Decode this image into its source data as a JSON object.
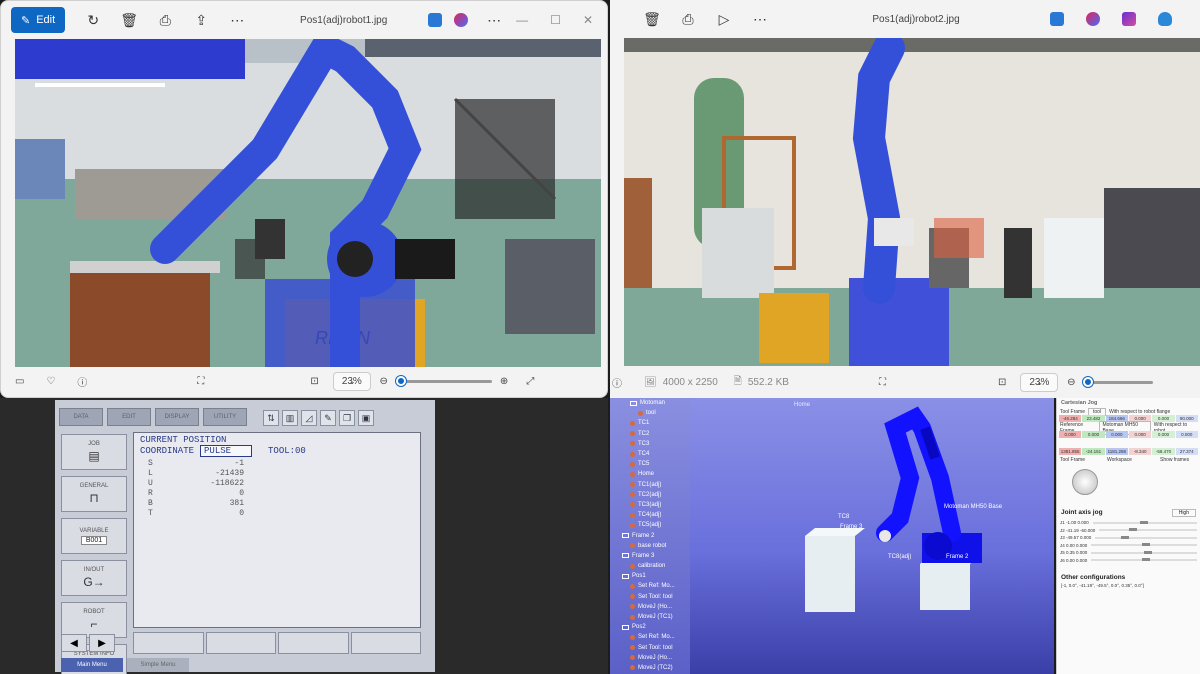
{
  "window1": {
    "edit_label": "Edit",
    "filename": "Pos1(adj)robot1.jpg",
    "zoom": "23%"
  },
  "window2": {
    "filename": "Pos1(adj)robot2.jpg",
    "dimensions": "4000 x 2250",
    "filesize": "552.2 KB",
    "zoom": "23%"
  },
  "pendant": {
    "tabs": [
      "DATA",
      "EDIT",
      "DISPLAY",
      "UTILITY"
    ],
    "side_buttons": [
      {
        "label": "JOB",
        "glyph": "▤"
      },
      {
        "label": "GENERAL",
        "glyph": "⊓"
      },
      {
        "label": "VARIABLE",
        "sub": "B001"
      },
      {
        "label": "IN/OUT",
        "glyph": "G→"
      },
      {
        "label": "ROBOT",
        "glyph": "⌐"
      },
      {
        "label": "SYSTEM INFO",
        "glyph": "▣"
      }
    ],
    "screen_title": "CURRENT POSITION",
    "coordinate_label": "COORDINATE",
    "coordinate_value": "PULSE",
    "tool_label": "TOOL:00",
    "axes": [
      {
        "axis": "S",
        "value": "-1"
      },
      {
        "axis": "L",
        "value": "-21439"
      },
      {
        "axis": "U",
        "value": "-118622"
      },
      {
        "axis": "R",
        "value": "0"
      },
      {
        "axis": "B",
        "value": "381"
      },
      {
        "axis": "T",
        "value": "0"
      }
    ],
    "menu_main": "Main Menu",
    "menu_simple": "Simple Menu"
  },
  "robodk": {
    "tree": [
      {
        "label": "Motoman",
        "kind": "frame",
        "indent": 2
      },
      {
        "label": "tool",
        "kind": "dot",
        "indent": 3
      },
      {
        "label": "TC1",
        "kind": "dot",
        "indent": 2
      },
      {
        "label": "TC2",
        "kind": "dot",
        "indent": 2
      },
      {
        "label": "TC3",
        "kind": "dot",
        "indent": 2
      },
      {
        "label": "TC4",
        "kind": "dot",
        "indent": 2
      },
      {
        "label": "TC5",
        "kind": "dot",
        "indent": 2
      },
      {
        "label": "Home",
        "kind": "dot",
        "indent": 2
      },
      {
        "label": "TC1(adj)",
        "kind": "dot",
        "indent": 2
      },
      {
        "label": "TC2(adj)",
        "kind": "dot",
        "indent": 2
      },
      {
        "label": "TC3(adj)",
        "kind": "dot",
        "indent": 2
      },
      {
        "label": "TC4(adj)",
        "kind": "dot",
        "indent": 2
      },
      {
        "label": "TC5(adj)",
        "kind": "dot",
        "indent": 2
      },
      {
        "label": "Frame 2",
        "kind": "frame",
        "indent": 1
      },
      {
        "label": "base robot",
        "kind": "dot",
        "indent": 2
      },
      {
        "label": "Frame 3",
        "kind": "frame",
        "indent": 1
      },
      {
        "label": "calibration",
        "kind": "dot",
        "indent": 2
      },
      {
        "label": "Pos1",
        "kind": "frame",
        "indent": 1
      },
      {
        "label": "Set Ref: Mo...",
        "kind": "dot",
        "indent": 2
      },
      {
        "label": "Set Tool: tool",
        "kind": "dot",
        "indent": 2
      },
      {
        "label": "MoveJ (Ho...",
        "kind": "dot",
        "indent": 2
      },
      {
        "label": "MoveJ (TC1)",
        "kind": "dot",
        "indent": 2
      },
      {
        "label": "Pos2",
        "kind": "frame",
        "indent": 1
      },
      {
        "label": "Set Ref: Mo...",
        "kind": "dot",
        "indent": 2
      },
      {
        "label": "Set Tool: tool",
        "kind": "dot",
        "indent": 2
      },
      {
        "label": "MoveJ (Ho...",
        "kind": "dot",
        "indent": 2
      },
      {
        "label": "MoveJ (TC2)",
        "kind": "dot",
        "indent": 2
      }
    ],
    "view_home": "Home",
    "label_tc8": "TC8",
    "label_frame3": "Frame 3",
    "label_robot": "Motoman MH50 Base",
    "label_tc8adj": "TC8(adj)",
    "label_frame2": "Frame 2",
    "panel": {
      "cartesian_jog": "Cartesian Jog",
      "tool_frame": "Tool Frame",
      "tool_frame_sel": "tool",
      "wrt_flange": "With respect to robot flange",
      "reference_frame": "Reference Frame",
      "reference_sel": "Motoman MH50 Base",
      "wrt_robot": "With respect to robot",
      "row1": [
        "-46.284",
        "23.482",
        "184.666",
        "0.000",
        "0.000",
        "90.000"
      ],
      "row2": [
        "0.000",
        "0.000",
        "0.000",
        "0.000",
        "0.000",
        "0.000"
      ],
      "row3": [
        "1381.855",
        "-24.151",
        "1181.288",
        "-8.340",
        "-58.470",
        "27.374"
      ],
      "tool_frame_label": "Tool Frame",
      "workspace": "Workspace",
      "show_frames": "Show frames",
      "joint_jog": "Joint axis jog",
      "high": "High",
      "joints": [
        "J1  -1.00  0.000",
        "J2  -41.19  -60.000",
        "J3  -49.57  0.000",
        "J4  0.00  0.000",
        "J5  0.35  0.000",
        "J6  0.00  0.000"
      ],
      "other_conf": "Other configurations",
      "other_values": "[-1, 0.0°, -41.19°, -49.5°, 0.0°, 0.35°, 0.0°]"
    }
  }
}
